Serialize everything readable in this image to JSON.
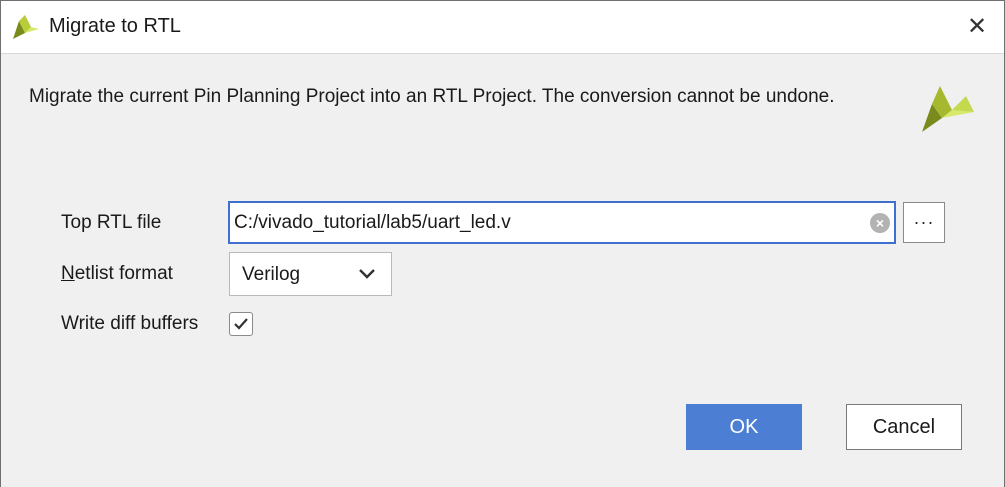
{
  "window": {
    "title": "Migrate to RTL",
    "logo_icon": "vivado-logo-icon",
    "close_icon": "close-icon"
  },
  "dialog": {
    "description": "Migrate the current Pin Planning Project into an RTL Project. The conversion cannot be undone.",
    "brand_icon": "vivado-logo-icon"
  },
  "form": {
    "top_rtl_file": {
      "label": "Top RTL file",
      "value": "C:/vivado_tutorial/lab5/uart_led.v",
      "clear_icon": "clear-icon",
      "browse_label": "···"
    },
    "netlist_format": {
      "label_first": "N",
      "label_rest": "etlist format",
      "selected": "Verilog",
      "chevron_icon": "chevron-down-icon"
    },
    "write_diff_buffers": {
      "label": "Write diff buffers",
      "checked": true
    }
  },
  "buttons": {
    "ok": "OK",
    "cancel": "Cancel"
  },
  "colors": {
    "accent": "#4c7fd4",
    "focus_border": "#3f6fcf",
    "logo_dark": "#7a8a1c",
    "logo_light": "#d6e96a",
    "content_bg": "#f0f0f0"
  }
}
